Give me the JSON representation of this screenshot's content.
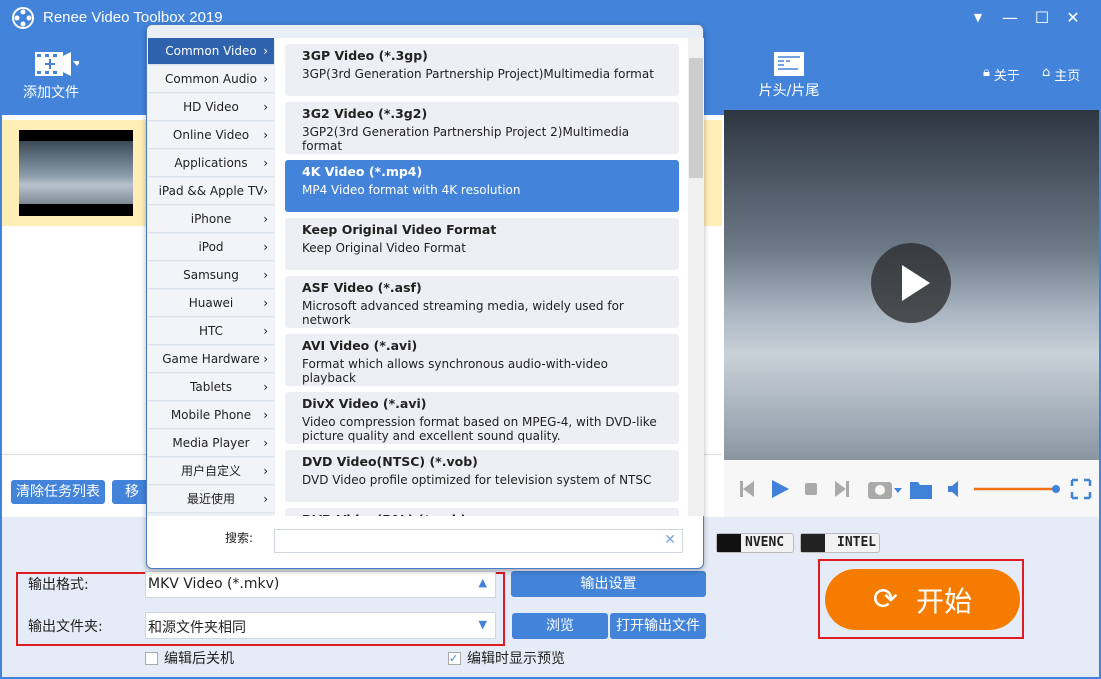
{
  "app": {
    "title": "Renee Video Toolbox 2019",
    "colors": {
      "primary": "#4384da",
      "accent": "#f57c00",
      "highlight": "#ff0000"
    }
  },
  "toolbar": {
    "add_file": "添加文件",
    "trim": "片头/片尾",
    "about": "关于",
    "home": "主页"
  },
  "task": {
    "clear": "清除任务列表",
    "move": "移"
  },
  "categories": [
    {
      "label": "Common Video",
      "selected": true
    },
    {
      "label": "Common Audio"
    },
    {
      "label": "HD Video"
    },
    {
      "label": "Online Video"
    },
    {
      "label": "Applications"
    },
    {
      "label": "iPad && Apple TV"
    },
    {
      "label": "iPhone"
    },
    {
      "label": "iPod"
    },
    {
      "label": "Samsung"
    },
    {
      "label": "Huawei"
    },
    {
      "label": "HTC"
    },
    {
      "label": "Game Hardware"
    },
    {
      "label": "Tablets"
    },
    {
      "label": "Mobile Phone"
    },
    {
      "label": "Media Player"
    },
    {
      "label": "用户自定义"
    },
    {
      "label": "最近使用"
    }
  ],
  "formats": [
    {
      "name": "3GP Video (*.3gp)",
      "desc": "3GP(3rd Generation Partnership Project)Multimedia format"
    },
    {
      "name": "3G2 Video (*.3g2)",
      "desc": "3GP2(3rd Generation Partnership Project 2)Multimedia format"
    },
    {
      "name": "4K Video (*.mp4)",
      "desc": "MP4 Video format with 4K resolution",
      "selected": true
    },
    {
      "name": "Keep Original Video Format",
      "desc": "Keep Original Video Format"
    },
    {
      "name": "ASF Video (*.asf)",
      "desc": "Microsoft advanced streaming media, widely used for network"
    },
    {
      "name": "AVI Video (*.avi)",
      "desc": "Format which allows synchronous audio-with-video playback"
    },
    {
      "name": "DivX Video (*.avi)",
      "desc": "Video compression format based on MPEG-4, with DVD-like picture quality and excellent sound quality."
    },
    {
      "name": "DVD Video(NTSC) (*.vob)",
      "desc": "DVD Video profile optimized for television system of NTSC"
    },
    {
      "name": "DVD Video(PAL) (*.vob)",
      "desc": ""
    }
  ],
  "search": {
    "label": "搜索:",
    "value": ""
  },
  "accel": {
    "nvenc": "NVENC",
    "intel": "INTEL"
  },
  "output": {
    "format_label": "输出格式:",
    "format_value": "MKV Video (*.mkv)",
    "folder_label": "输出文件夹:",
    "folder_value": "和源文件夹相同",
    "settings": "输出设置",
    "browse": "浏览",
    "open": "打开输出文件"
  },
  "options": {
    "shutdown": "编辑后关机",
    "shutdown_checked": false,
    "preview": "编辑时显示预览",
    "preview_checked": true
  },
  "start": "开始",
  "player": {
    "volume": 1.0
  }
}
